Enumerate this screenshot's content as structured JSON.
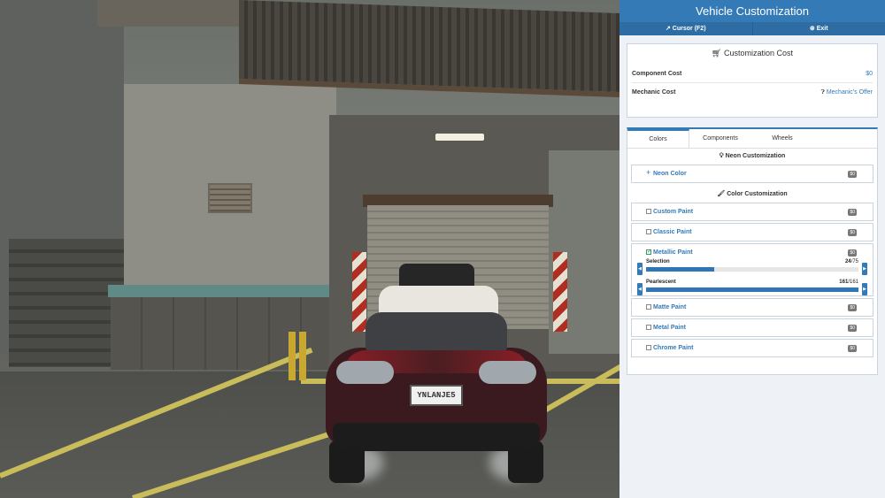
{
  "panel": {
    "title": "Vehicle Customization",
    "nav": [
      {
        "icon": "cursor-icon",
        "label": "Cursor (F2)"
      },
      {
        "icon": "exit-icon",
        "label": "Exit"
      }
    ]
  },
  "cost": {
    "title": "Customization Cost",
    "rows": [
      {
        "label": "Component Cost",
        "value": "$0"
      },
      {
        "label": "Mechanic Cost",
        "value": "Mechanic's Offer"
      }
    ]
  },
  "tabs": [
    "Colors",
    "Components",
    "Wheels"
  ],
  "neon": {
    "title": "Neon Customization",
    "items": [
      {
        "label": "Neon Color",
        "price": "$0"
      }
    ]
  },
  "color": {
    "title": "Color Customization",
    "items": [
      {
        "label": "Custom Paint",
        "price": "$0",
        "checked": false
      },
      {
        "label": "Classic Paint",
        "price": "$0",
        "checked": false
      },
      {
        "label": "Metallic Paint",
        "price": "$0",
        "checked": true
      },
      {
        "label": "Matte Paint",
        "price": "$0",
        "checked": false
      },
      {
        "label": "Metal Paint",
        "price": "$0",
        "checked": false
      },
      {
        "label": "Chrome Paint",
        "price": "$0",
        "checked": false
      }
    ],
    "sliders": [
      {
        "label": "Selection",
        "current": "24",
        "max": "/75",
        "fraction": 0.32
      },
      {
        "label": "Pearlescent",
        "current": "161",
        "max": "/161",
        "fraction": 1.0
      }
    ]
  },
  "scene": {
    "plate": "YNLANJE5"
  },
  "colors": {
    "accent": "#337ab7",
    "panel_bg": "#eef1f5",
    "check": "#3c9a5f"
  }
}
